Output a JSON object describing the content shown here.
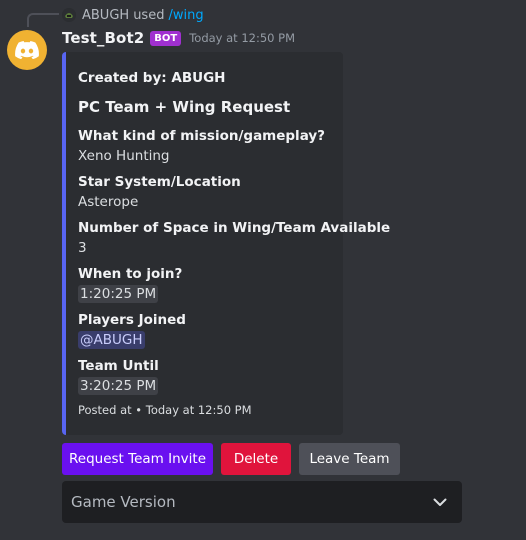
{
  "reply": {
    "username": "ABUGH",
    "used_text": "used",
    "command": "/wing"
  },
  "message": {
    "username": "Test_Bot2",
    "badge": "BOT",
    "timestamp": "Today at 12:50 PM"
  },
  "embed": {
    "accent_color": "#5865f2",
    "author": "Created by: ABUGH",
    "title": "PC Team + Wing Request",
    "fields": [
      {
        "name": "What kind of mission/gameplay?",
        "value": "Xeno Hunting"
      },
      {
        "name": "Star System/Location",
        "value": "Asterope"
      },
      {
        "name": "Number of Space in Wing/Team Available",
        "value": "3"
      },
      {
        "name": "When to join?",
        "value": "1:20:25 PM"
      },
      {
        "name": "Players Joined",
        "value": "@ABUGH"
      },
      {
        "name": "Team Until",
        "value": "3:20:25 PM"
      }
    ],
    "footer": "Posted at • Today at 12:50 PM"
  },
  "buttons": {
    "request": "Request Team Invite",
    "delete": "Delete",
    "leave": "Leave Team"
  },
  "select": {
    "placeholder": "Game Version"
  },
  "icons": {
    "avatar": "discord-logo-icon",
    "reply_avatar": "helmet-avatar-icon",
    "select_chevron": "chevron-down-icon"
  }
}
